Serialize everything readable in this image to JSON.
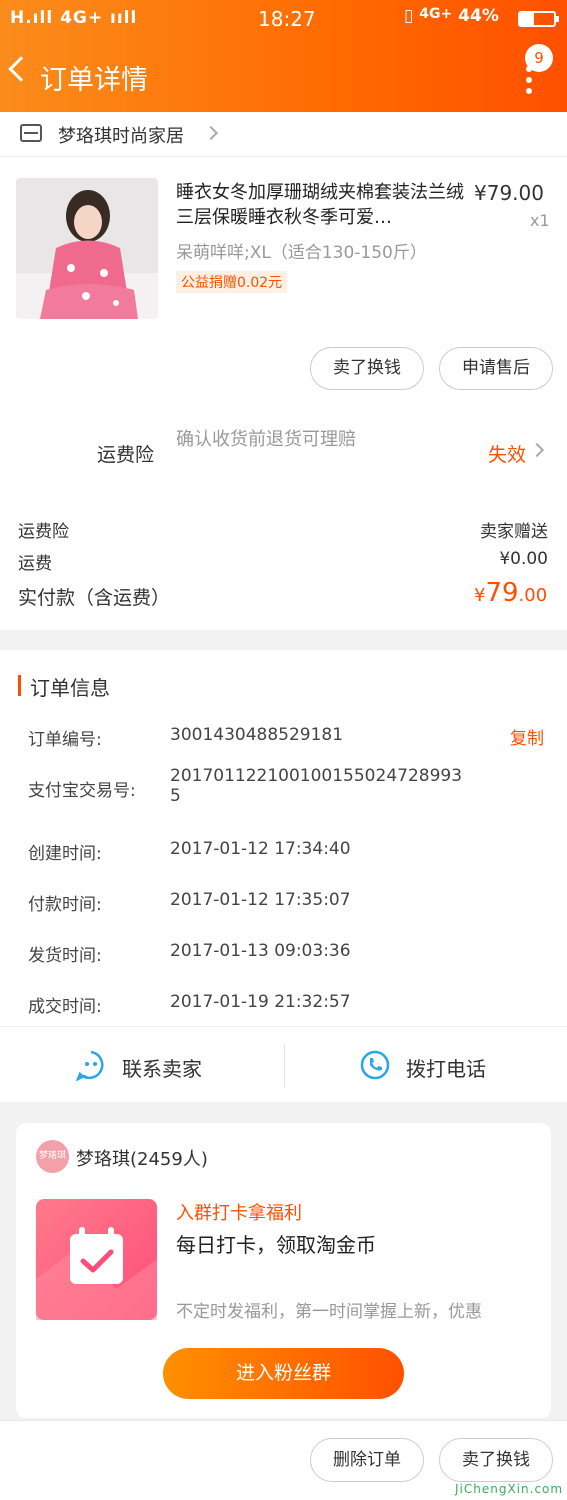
{
  "status_bar": {
    "signal": "H.ıll 4G+ ııll",
    "time": "18:27",
    "network": "4G+",
    "battery": "44%"
  },
  "header": {
    "title": "订单详情",
    "badge_count": "9"
  },
  "shop": {
    "name": "梦珞琪时尚家居"
  },
  "product": {
    "title": "睡衣女冬加厚珊瑚绒夹棉套装法兰绒三层保暖睡衣秋冬季可爱…",
    "price": "¥79.00",
    "quantity": "x1",
    "sku": "呆萌咩咩;XL（适合130-150斤）",
    "charity": "公益捐赠0.02元"
  },
  "product_actions": {
    "sell": "卖了换钱",
    "after_sale": "申请售后"
  },
  "insurance": {
    "label": "运费险",
    "desc": "确认收货前退货可理赔",
    "status": "失效"
  },
  "costs": [
    {
      "label": "运费险",
      "value": "卖家赠送"
    },
    {
      "label": "运费",
      "value": "¥0.00"
    }
  ],
  "total": {
    "label": "实付款（含运费）",
    "currency": "¥",
    "integer": "79",
    "decimal": ".00"
  },
  "order_info": {
    "title": "订单信息",
    "copy": "复制",
    "rows": [
      {
        "label": "订单编号:",
        "value": "3001430488529181"
      },
      {
        "label": "支付宝交易号:",
        "value": "2017011221001001550247289935"
      },
      {
        "label": "创建时间:",
        "value": "2017-01-12 17:34:40"
      },
      {
        "label": "付款时间:",
        "value": "2017-01-12 17:35:07"
      },
      {
        "label": "发货时间:",
        "value": "2017-01-13 09:03:36"
      },
      {
        "label": "成交时间:",
        "value": "2017-01-19 21:32:57"
      }
    ]
  },
  "contact": {
    "seller": "联系卖家",
    "phone": "拨打电话"
  },
  "fan_group": {
    "avatar_text": "梦珞琪",
    "name": "梦珞琪(2459人)",
    "promo_title": "入群打卡拿福利",
    "promo_subtitle": "每日打卡，领取淘金币",
    "promo_desc": "不定时发福利，第一时间掌握上新，优惠",
    "enter": "进入粉丝群"
  },
  "bottom_bar": {
    "delete": "删除订单",
    "sell": "卖了换钱"
  },
  "watermark": "JiChengXin.com",
  "colors": {
    "accent": "#ff5000",
    "header_start": "#fb8c1c"
  }
}
